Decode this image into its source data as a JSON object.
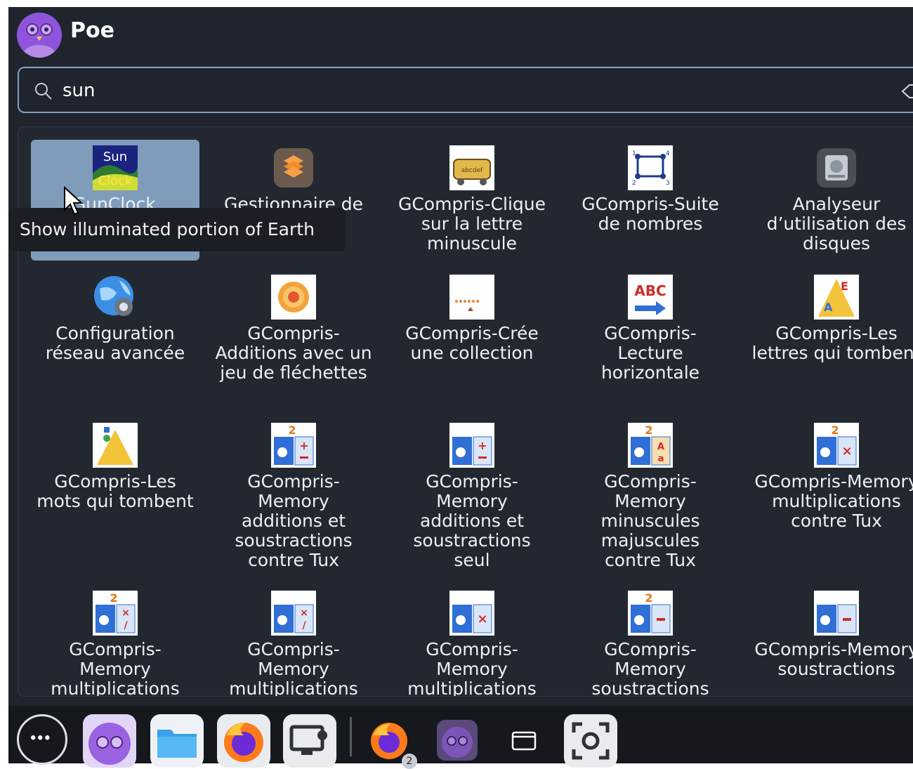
{
  "app": {
    "title": "Poe",
    "avatar_icon": "owl-avatar-icon"
  },
  "search": {
    "value": "sun",
    "placeholder": "",
    "icon": "search-icon",
    "clear_icon": "backspace-clear-icon"
  },
  "tooltip": {
    "text": "Show illuminated portion of Earth"
  },
  "apps": [
    {
      "label": "SunClock",
      "icon": "sunclock-icon",
      "selected": true
    },
    {
      "label": "Gestionnaire de",
      "icon": "dropbox-package-icon"
    },
    {
      "label": "GCompris-Clique sur la lettre minuscule",
      "icon": "gcompris-train-icon"
    },
    {
      "label": "GCompris-Suite de nombres",
      "icon": "gcompris-number-sequence-icon"
    },
    {
      "label": "Analyseur d’utilisation des disques",
      "icon": "disk-analyzer-icon"
    },
    {
      "label": "Configuration réseau avancée",
      "icon": "network-settings-icon"
    },
    {
      "label": "GCompris-Additions avec un jeu de fléchettes",
      "icon": "gcompris-target-icon"
    },
    {
      "label": "GCompris-Crée une collection",
      "icon": "gcompris-collection-icon"
    },
    {
      "label": "GCompris-Lecture horizontale",
      "icon": "gcompris-abc-reading-icon"
    },
    {
      "label": "GCompris-Les lettres qui tombent",
      "icon": "gcompris-falling-letters-icon"
    },
    {
      "label": "GCompris-Les mots qui tombent",
      "icon": "gcompris-falling-words-icon"
    },
    {
      "label": "GCompris-Memory additions et soustractions contre Tux",
      "icon": "gcompris-memory-plus-minus-tux-icon"
    },
    {
      "label": "GCompris-Memory additions et soustractions seul",
      "icon": "gcompris-memory-plus-minus-icon"
    },
    {
      "label": "GCompris-Memory minuscules majuscules contre Tux",
      "icon": "gcompris-memory-letters-icon"
    },
    {
      "label": "GCompris-Memory multiplications contre Tux",
      "icon": "gcompris-memory-times-tux-icon"
    },
    {
      "label": "GCompris-Memory multiplications",
      "icon": "gcompris-memory-times-div-tux-icon"
    },
    {
      "label": "GCompris-Memory multiplications",
      "icon": "gcompris-memory-times-div-icon"
    },
    {
      "label": "GCompris-Memory multiplications",
      "icon": "gcompris-memory-times-icon"
    },
    {
      "label": "GCompris-Memory soustractions",
      "icon": "gcompris-memory-minus-tux-icon"
    },
    {
      "label": "GCompris-Memory soustractions",
      "icon": "gcompris-memory-minus-icon"
    }
  ],
  "dock": {
    "items": [
      {
        "icon": "app-grid-icon"
      },
      {
        "icon": "poe-app-icon"
      },
      {
        "icon": "files-folder-icon"
      },
      {
        "icon": "firefox-icon"
      },
      {
        "icon": "remote-desktop-icon"
      },
      {
        "icon": "firefox-icon",
        "badge": "2"
      },
      {
        "icon": "poe-app-icon"
      },
      {
        "icon": "window-icon"
      },
      {
        "icon": "screenshot-icon"
      }
    ]
  }
}
